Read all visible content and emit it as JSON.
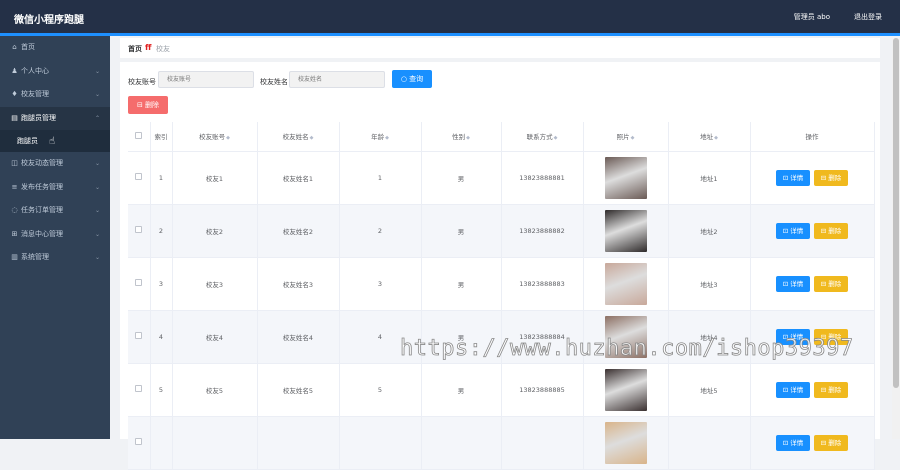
{
  "app": {
    "title": "微信小程序跑腿",
    "admin": "管理员 abo",
    "logout": "退出登录"
  },
  "sidebar": {
    "items": [
      {
        "icon": "home-icon",
        "glyph": "⌂",
        "label": "首页",
        "chev": ""
      },
      {
        "icon": "user-icon",
        "glyph": "♟",
        "label": "个人中心",
        "chev": "⌄"
      },
      {
        "icon": "pin-icon",
        "glyph": "♦",
        "label": "校友管理",
        "chev": "⌄"
      },
      {
        "icon": "runner-icon",
        "glyph": "▤",
        "label": "跑腿员管理",
        "chev": "⌃"
      },
      {
        "icon": "",
        "glyph": "",
        "label": "跑腿员",
        "chev": ""
      },
      {
        "icon": "chat-icon",
        "glyph": "◫",
        "label": "校友动态管理",
        "chev": "⌄"
      },
      {
        "icon": "task-icon",
        "glyph": "≡",
        "label": "发布任务管理",
        "chev": "⌄"
      },
      {
        "icon": "power-icon",
        "glyph": "◌",
        "label": "任务订单管理",
        "chev": "⌄"
      },
      {
        "icon": "message-icon",
        "glyph": "⊞",
        "label": "消息中心管理",
        "chev": "⌄"
      },
      {
        "icon": "system-icon",
        "glyph": "▥",
        "label": "系统管理",
        "chev": "⌄"
      }
    ]
  },
  "breadcrumb": {
    "home": "首页",
    "sep": "ff",
    "current": "校友"
  },
  "search": {
    "account_label": "校友账号",
    "account_placeholder": "校友账号",
    "name_label": "校友姓名",
    "name_placeholder": "校友姓名",
    "query_label": "○ 查询"
  },
  "delete_all_label": "⊟ 删除",
  "table": {
    "headers": [
      "索引",
      "校友账号",
      "校友姓名",
      "年龄",
      "性别",
      "联系方式",
      "照片",
      "地址",
      "操作"
    ],
    "rows": [
      {
        "idx": "1",
        "account": "校友1",
        "name": "校友姓名1",
        "age": "1",
        "gender": "男",
        "phone": "13823888881",
        "address": "地址1",
        "photo": "#6a5a55"
      },
      {
        "idx": "2",
        "account": "校友2",
        "name": "校友姓名2",
        "age": "2",
        "gender": "男",
        "phone": "13823888882",
        "address": "地址2",
        "photo": "#2e2a2a"
      },
      {
        "idx": "3",
        "account": "校友3",
        "name": "校友姓名3",
        "age": "3",
        "gender": "男",
        "phone": "13823888883",
        "address": "地址3",
        "photo": "#c8a89a"
      },
      {
        "idx": "4",
        "account": "校友4",
        "name": "校友姓名4",
        "age": "4",
        "gender": "男",
        "phone": "13823888884",
        "address": "地址4",
        "photo": "#8c6f63"
      },
      {
        "idx": "5",
        "account": "校友5",
        "name": "校友姓名5",
        "age": "5",
        "gender": "男",
        "phone": "13823888885",
        "address": "地址5",
        "photo": "#3a3030"
      },
      {
        "idx": "",
        "account": "",
        "name": "",
        "age": "",
        "gender": "",
        "phone": "",
        "address": "",
        "photo": "#d9b48a"
      }
    ],
    "detail_label": "⊡ 详情",
    "delete_label": "⊟ 删除"
  },
  "watermark": "https://www.huzhan.com/ishop39397"
}
